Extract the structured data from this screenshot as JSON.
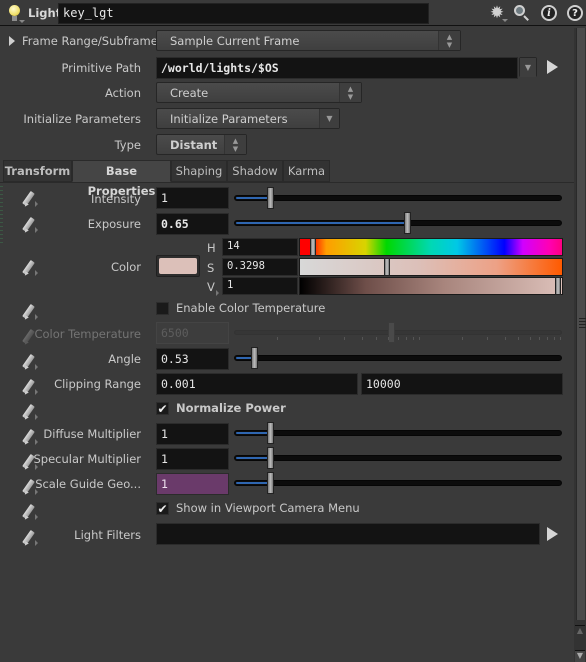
{
  "header": {
    "node_type": "Light",
    "node_name": "key_lgt",
    "icons": [
      "lightbulb-icon",
      "gear-icon",
      "search-icon",
      "info-icon",
      "help-icon"
    ]
  },
  "frame_range": {
    "label": "Frame Range/Subframes",
    "value": "Sample Current Frame"
  },
  "primitive_path": {
    "label": "Primitive Path",
    "value": "/world/lights/$OS"
  },
  "action": {
    "label": "Action",
    "value": "Create"
  },
  "initialize_parameters": {
    "label": "Initialize Parameters",
    "value": "Initialize Parameters"
  },
  "type": {
    "label": "Type",
    "value": "Distant"
  },
  "tabs": [
    {
      "label": "Transform",
      "active": false
    },
    {
      "label": "Base Properties",
      "active": true
    },
    {
      "label": "Shaping",
      "active": false
    },
    {
      "label": "Shadow",
      "active": false
    },
    {
      "label": "Karma",
      "active": false
    }
  ],
  "params": {
    "intensity": {
      "label": "Intensity",
      "value": "1",
      "slider_fraction": 0.1
    },
    "exposure": {
      "label": "Exposure",
      "value": "0.65",
      "slider_fraction": 0.53
    },
    "color": {
      "label": "Color",
      "swatch": "#dcc0b9",
      "h": {
        "label": "H",
        "value": "14",
        "fraction": 0.039
      },
      "s": {
        "label": "S",
        "value": "0.3298",
        "fraction": 0.33
      },
      "v": {
        "label": "V",
        "value": "1",
        "fraction": 1.0
      }
    },
    "enable_color_temperature": {
      "label": "Enable Color Temperature",
      "checked": false
    },
    "color_temperature": {
      "label": "Color Temperature",
      "value": "6500",
      "slider_fraction": 0.48,
      "disabled": true
    },
    "angle": {
      "label": "Angle",
      "value": "0.53",
      "slider_fraction": 0.05
    },
    "clipping_range": {
      "label": "Clipping Range",
      "near": "0.001",
      "far": "10000"
    },
    "normalize_power": {
      "label": "Normalize Power",
      "checked": true
    },
    "diffuse_multiplier": {
      "label": "Diffuse Multiplier",
      "value": "1",
      "slider_fraction": 0.1
    },
    "specular_multiplier": {
      "label": "Specular Multiplier",
      "value": "1",
      "slider_fraction": 0.1
    },
    "scale_guide_geo": {
      "label": "Scale Guide Geo...",
      "value": "1",
      "slider_fraction": 0.1
    },
    "show_in_viewport_camera_menu": {
      "label": "Show in Viewport Camera Menu",
      "checked": true
    },
    "light_filters": {
      "label": "Light Filters",
      "value": ""
    }
  },
  "colors": {
    "accent_blue": "#2f66b0",
    "override_purple": "#6a3a6a",
    "background": "#3a3a3a"
  }
}
